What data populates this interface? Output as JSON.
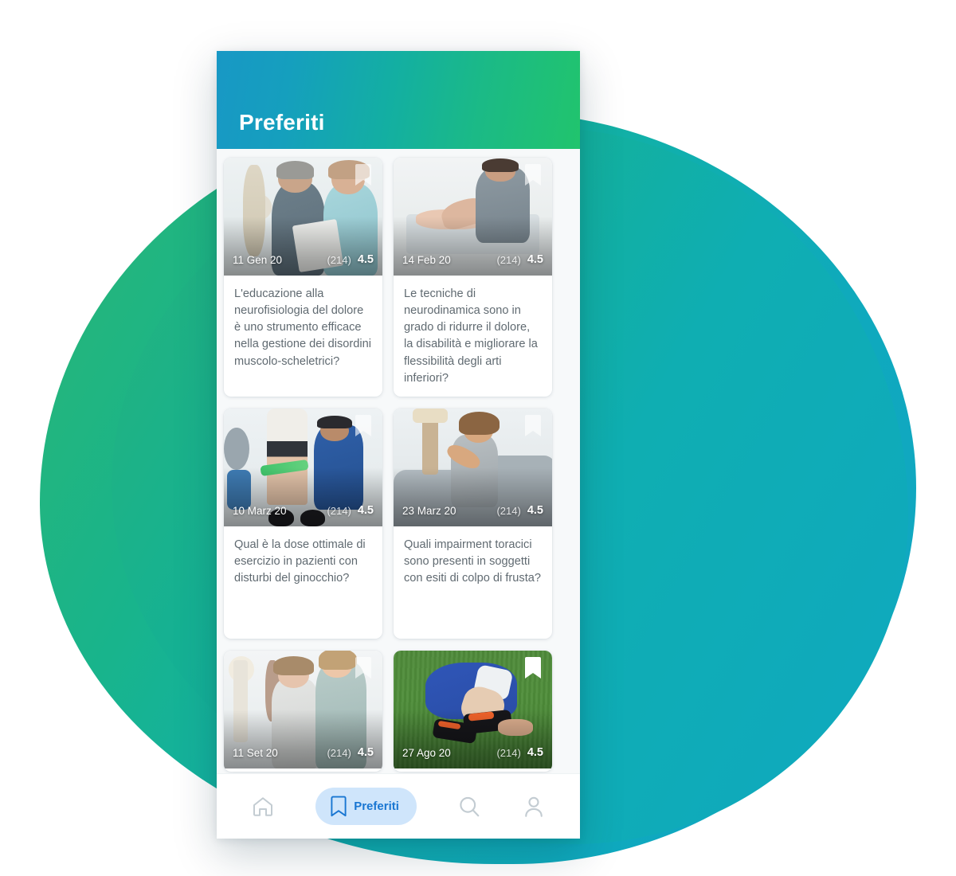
{
  "app": {
    "header": {
      "title": "Preferiti",
      "gradient_start": "#1898C5",
      "gradient_end": "#21C46D"
    },
    "background": {
      "blob_gradient_start": "#2BB673",
      "blob_gradient_end": "#11A6C4"
    }
  },
  "cards": [
    {
      "date": "11 Gen 20",
      "review_count": "(214)",
      "rating": "4.5",
      "bookmark_icon": "bookmark-icon",
      "title": "L'educazione alla neurofisiologia del dolore è uno strumento efficace nella gestione dei disordini muscolo-scheletrici?"
    },
    {
      "date": "14 Feb 20",
      "review_count": "(214)",
      "rating": "4.5",
      "bookmark_icon": "bookmark-icon",
      "title": "Le tecniche di neurodinamica sono in grado di ridurre il dolore, la disabilità e migliorare la flessibilità degli arti inferiori?"
    },
    {
      "date": "10 Marz 20",
      "review_count": "(214)",
      "rating": "4.5",
      "bookmark_icon": "bookmark-icon",
      "title": "Qual è la dose ottimale di esercizio in pazienti con disturbi del ginocchio?"
    },
    {
      "date": "23 Marz 20",
      "review_count": "(214)",
      "rating": "4.5",
      "bookmark_icon": "bookmark-icon",
      "title": "Quali impairment toracici sono presenti in soggetti con esiti di colpo di frusta?"
    },
    {
      "date": "11 Set 20",
      "review_count": "(214)",
      "rating": "4.5",
      "bookmark_icon": "bookmark-icon",
      "title": ""
    },
    {
      "date": "27 Ago 20",
      "review_count": "(214)",
      "rating": "4.5",
      "bookmark_icon": "bookmark-icon",
      "title": ""
    }
  ],
  "bottom_nav": {
    "items": [
      {
        "icon": "home-icon",
        "label": "",
        "active": false
      },
      {
        "icon": "bookmark-icon",
        "label": "Preferiti",
        "active": true
      },
      {
        "icon": "search-icon",
        "label": "",
        "active": false
      },
      {
        "icon": "person-icon",
        "label": "",
        "active": false
      }
    ],
    "active_color": "#1976d2",
    "active_pill_bg": "#cfe5fb",
    "inactive_color": "#c3ccd2"
  }
}
